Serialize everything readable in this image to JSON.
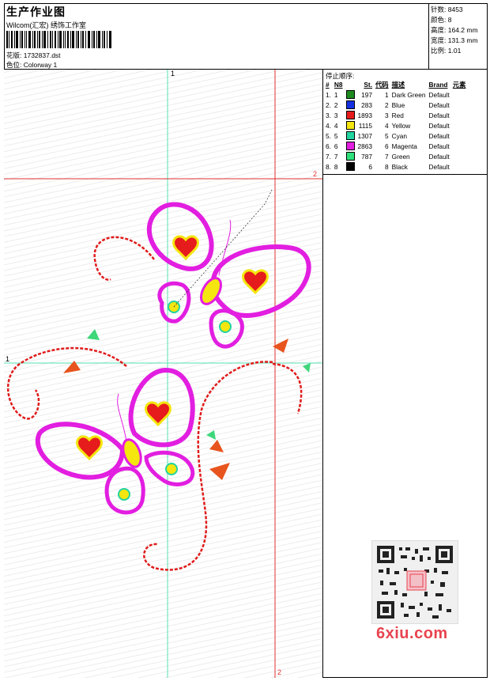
{
  "header": {
    "title": "生产作业图",
    "company": "Wilcom(汇宏) 绣饰工作室",
    "design_label": "花版:",
    "design_value": "1732837.dst",
    "colorway_label": "色位:",
    "colorway_value": "Colorway 1"
  },
  "stats": {
    "stitches_label": "针数:",
    "stitches_value": "8453",
    "colors_label": "颜色:",
    "colors_value": "8",
    "height_label": "高度:",
    "height_value": "164.2 mm",
    "width_label": "宽度:",
    "width_value": "131.3 mm",
    "scale_label": "比例:",
    "scale_value": "1.01"
  },
  "stop_sequence": {
    "title": "停止顺序:",
    "columns": [
      "#",
      "N8",
      "St.",
      "代码",
      "描述",
      "Brand",
      "元素"
    ],
    "rows": [
      {
        "idx": "1.",
        "n": "1",
        "color": "#1e8a1e",
        "st": "197",
        "code": "1",
        "desc": "Dark Green",
        "brand": "Default"
      },
      {
        "idx": "2.",
        "n": "2",
        "color": "#1530e0",
        "st": "283",
        "code": "2",
        "desc": "Blue",
        "brand": "Default"
      },
      {
        "idx": "3.",
        "n": "3",
        "color": "#e61b1b",
        "st": "1893",
        "code": "3",
        "desc": "Red",
        "brand": "Default"
      },
      {
        "idx": "4.",
        "n": "4",
        "color": "#f4e60e",
        "st": "1115",
        "code": "4",
        "desc": "Yellow",
        "brand": "Default"
      },
      {
        "idx": "5.",
        "n": "5",
        "color": "#22d4a0",
        "st": "1307",
        "code": "5",
        "desc": "Cyan",
        "brand": "Default"
      },
      {
        "idx": "6.",
        "n": "6",
        "color": "#e21ee0",
        "st": "2863",
        "code": "6",
        "desc": "Magenta",
        "brand": "Default"
      },
      {
        "idx": "7.",
        "n": "7",
        "color": "#2ee07a",
        "st": "787",
        "code": "7",
        "desc": "Green",
        "brand": "Default"
      },
      {
        "idx": "8.",
        "n": "8",
        "color": "#000000",
        "st": "6",
        "code": "8",
        "desc": "Black",
        "brand": "Default"
      }
    ]
  },
  "markers": {
    "v1_top": "1",
    "h2_right": "2",
    "h1_left": "1",
    "v2_bottom": "2"
  },
  "watermark": {
    "site": "6xiu.com"
  }
}
